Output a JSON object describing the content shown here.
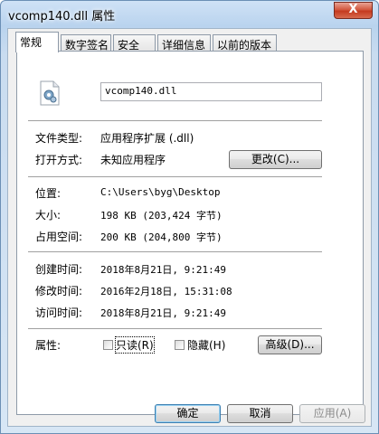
{
  "window": {
    "title": "vcomp140.dll 属性",
    "close_label": "X"
  },
  "tabs": [
    {
      "label": "常规"
    },
    {
      "label": "数字签名"
    },
    {
      "label": "安全"
    },
    {
      "label": "详细信息"
    },
    {
      "label": "以前的版本"
    }
  ],
  "general": {
    "filename": "vcomp140.dll",
    "file_type_label": "文件类型:",
    "file_type_value": "应用程序扩展 (.dll)",
    "open_with_label": "打开方式:",
    "open_with_value": "未知应用程序",
    "change_button": "更改(C)...",
    "location_label": "位置:",
    "location_value": "C:\\Users\\byg\\Desktop",
    "size_label": "大小:",
    "size_value": "198 KB (203,424 字节)",
    "size_on_disk_label": "占用空间:",
    "size_on_disk_value": "200 KB (204,800 字节)",
    "created_label": "创建时间:",
    "created_value": "2018年8月21日, 9:21:49",
    "modified_label": "修改时间:",
    "modified_value": "2016年2月18日, 15:31:08",
    "accessed_label": "访问时间:",
    "accessed_value": "2018年8月21日, 9:21:49",
    "attributes_label": "属性:",
    "readonly_label": "只读(R)",
    "readonly_checked": false,
    "hidden_label": "隐藏(H)",
    "hidden_checked": false,
    "advanced_button": "高级(D)..."
  },
  "footer": {
    "ok_button": "确定",
    "cancel_button": "取消",
    "apply_button": "应用(A)"
  }
}
